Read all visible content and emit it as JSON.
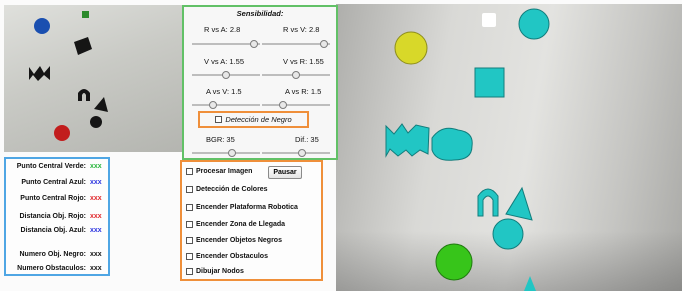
{
  "sensitivity": {
    "title": "Sensibilidad:",
    "sliders": [
      {
        "label": "R vs A: 2.8",
        "level": 0.96
      },
      {
        "label": "R vs V: 2.8",
        "level": 0.96
      },
      {
        "label": "V vs A: 1.55",
        "level": 0.5
      },
      {
        "label": "V vs R: 1.55",
        "level": 0.5
      },
      {
        "label": "A vs V: 1.5",
        "level": 0.28
      },
      {
        "label": "A vs R: 1.5",
        "level": 0.28
      }
    ],
    "black_detection": {
      "label": "Detección de Negro",
      "checked": false
    },
    "bottom_sliders": [
      {
        "label": "BGR: 35",
        "level": 0.6
      },
      {
        "label": "Dif.: 35",
        "level": 0.6
      }
    ]
  },
  "info": {
    "rows": [
      {
        "label": "Punto Central Verde:",
        "value": "xxx",
        "color": "#27b53b"
      },
      {
        "label": "Punto Central Azul:",
        "value": "xxx",
        "color": "#2a33e0"
      },
      {
        "label": "Punto Central Rojo:",
        "value": "xxx",
        "color": "#e0262a"
      },
      {
        "label": "Distancia Obj. Rojo:",
        "value": "xxx",
        "color": "#e0262a"
      },
      {
        "label": "Distancia Obj. Azul:",
        "value": "xxx",
        "color": "#2a33e0"
      },
      {
        "label": "Numero Obj. Negro:",
        "value": "xxx",
        "color": "#111111"
      },
      {
        "label": "Numero Obstaculos:",
        "value": "xxx",
        "color": "#111111"
      }
    ]
  },
  "options": {
    "pause_label": "Pausar",
    "items": [
      {
        "label": "Procesar Imagen",
        "checked": false
      },
      {
        "label": "Detección de Colores",
        "checked": false
      },
      {
        "label": "Encender Plataforma Robotica",
        "checked": false
      },
      {
        "label": "Encender Zona de Llegada",
        "checked": false
      },
      {
        "label": "Encender Objetos Negros",
        "checked": false
      },
      {
        "label": "Encender Obstaculos",
        "checked": false
      },
      {
        "label": "Dibujar Nodos",
        "checked": false
      }
    ]
  },
  "colors": {
    "green_border": "#62c167",
    "orange_border": "#ef8f3a",
    "blue_border": "#4fa6e4",
    "cyan_object": "#21c6c4",
    "yellow_object": "#d8d829",
    "green_object": "#37c51a"
  }
}
